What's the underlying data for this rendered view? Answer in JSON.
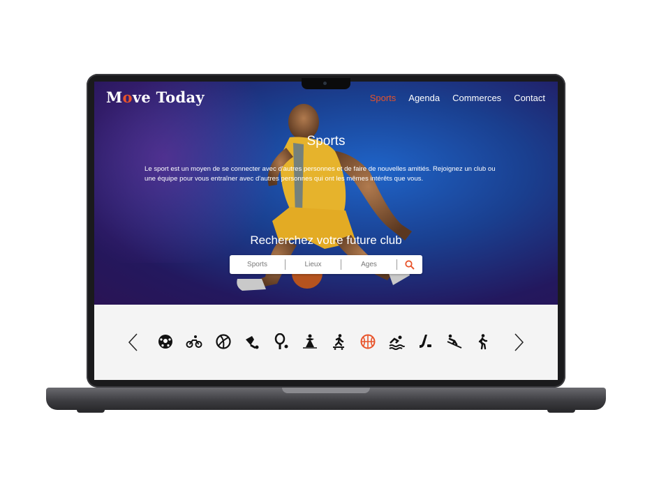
{
  "brand": {
    "logo_prefix": "M",
    "logo_o": "o",
    "logo_suffix": "ve Today"
  },
  "nav": {
    "items": [
      "Sports",
      "Agenda",
      "Commerces",
      "Contact"
    ],
    "active": "Sports"
  },
  "hero": {
    "title": "Sports",
    "text": "Le sport est un moyen de se connecter avec d'autres personnes et de faire de nouvelles amitiés. Rejoignez un club ou une équipe pour vous entraîner avec d'autres personnes qui ont les mêmes intérêts que vous."
  },
  "search": {
    "title": "Recherchez votre future club",
    "fields": [
      "Sports",
      "Lieux",
      "Ages"
    ]
  },
  "sports_icons": [
    "football-icon",
    "cycling-icon",
    "volleyball-icon",
    "badminton-icon",
    "tennis-icon",
    "dance-icon",
    "skateboarding-icon",
    "basketball-icon",
    "swimming-icon",
    "hockey-icon",
    "skiing-icon",
    "hiking-icon"
  ],
  "colors": {
    "accent": "#e8532a",
    "text_on_hero": "#ffffff",
    "icon": "#111111"
  }
}
